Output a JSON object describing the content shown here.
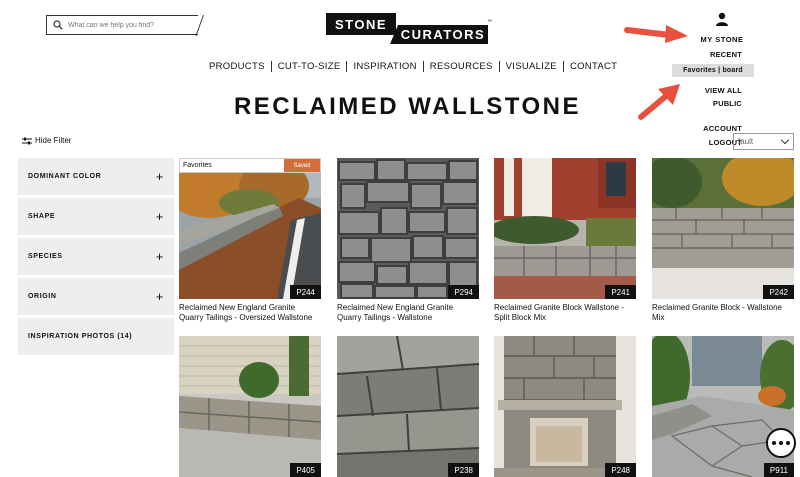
{
  "search": {
    "placeholder": "What can we help you find?"
  },
  "logo": {
    "line1": "STONE",
    "line2": "CURATORS",
    "tm": "™"
  },
  "account": {
    "label": "MY STONE",
    "menu": {
      "recent": "RECENT",
      "favorites": "Favorites | board",
      "view_all": "VIEW ALL",
      "public": "PUBLIC",
      "account": "ACCOUNT",
      "logout": "LOGOUT"
    }
  },
  "nav": [
    "PRODUCTS",
    "CUT-TO-SIZE",
    "INSPIRATION",
    "RESOURCES",
    "VISUALIZE",
    "CONTACT"
  ],
  "page_title": "RECLAIMED WALLSTONE",
  "hide_filter": "Hide Filter",
  "sort": {
    "value": "fault"
  },
  "filters": [
    {
      "label": "DOMINANT COLOR",
      "icon": "plus-icon"
    },
    {
      "label": "SHAPE",
      "icon": "plus-icon"
    },
    {
      "label": "SPECIES",
      "icon": "plus-icon"
    },
    {
      "label": "ORIGIN",
      "icon": "plus-icon"
    },
    {
      "label": "INSPIRATION PHOTOS  (14)"
    }
  ],
  "favorite_bar": {
    "label": "Favorites",
    "status": "Saved"
  },
  "products": [
    {
      "code": "P244",
      "name": "Reclaimed New England Granite Quarry Tailings - Oversized Wallstone"
    },
    {
      "code": "P294",
      "name": "Reclaimed New England Granite Quarry Tailings - Wallstone"
    },
    {
      "code": "P241",
      "name": "Reclaimed Granite Block Wallstone - Split Block Mix"
    },
    {
      "code": "P242",
      "name": "Reclaimed Granite Block - Wallstone Mix"
    },
    {
      "code": "P405",
      "name": ""
    },
    {
      "code": "P238",
      "name": ""
    },
    {
      "code": "P248",
      "name": ""
    },
    {
      "code": "P911",
      "name": ""
    }
  ],
  "colors": {
    "accent": "#d06f3c",
    "arrow": "#e8503e",
    "filter_bg": "#eeeeee",
    "logo": "#111111"
  }
}
